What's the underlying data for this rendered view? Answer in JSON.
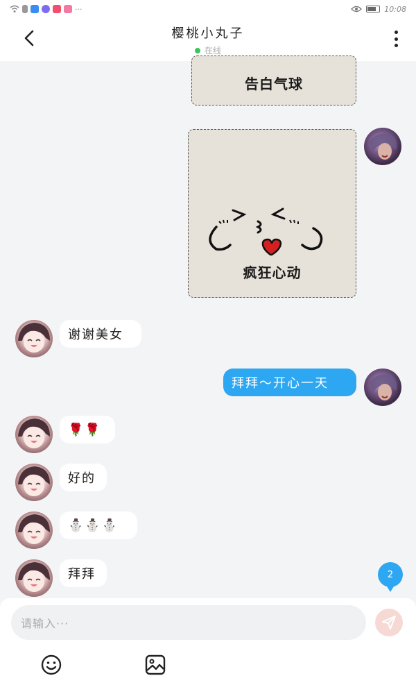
{
  "status_bar": {
    "time": "10:08"
  },
  "header": {
    "title": "樱桃小丸子",
    "status": "在线"
  },
  "messages": {
    "card1": {
      "text": "告白气球"
    },
    "card2": {
      "text": "疯狂心动"
    },
    "m1": {
      "text": "谢谢美女"
    },
    "m2": {
      "text": "拜拜～开心一天"
    },
    "m3": {
      "text": "🌹🌹"
    },
    "m4": {
      "text": "好的"
    },
    "m5": {
      "text": "⛄⛄⛄"
    },
    "m6": {
      "text": "拜拜"
    }
  },
  "unread_badge": {
    "count": "2"
  },
  "input": {
    "placeholder": "请输入···"
  },
  "icons": {
    "back": "chevron-left-icon",
    "more": "more-vertical-icon",
    "send": "send-icon",
    "emoji": "emoji-icon",
    "image": "image-icon"
  },
  "colors": {
    "accent": "#2ea7f2",
    "online": "#3bc45a",
    "card_bg": "#e6e2d9",
    "send_disabled": "#f6d9d4"
  }
}
